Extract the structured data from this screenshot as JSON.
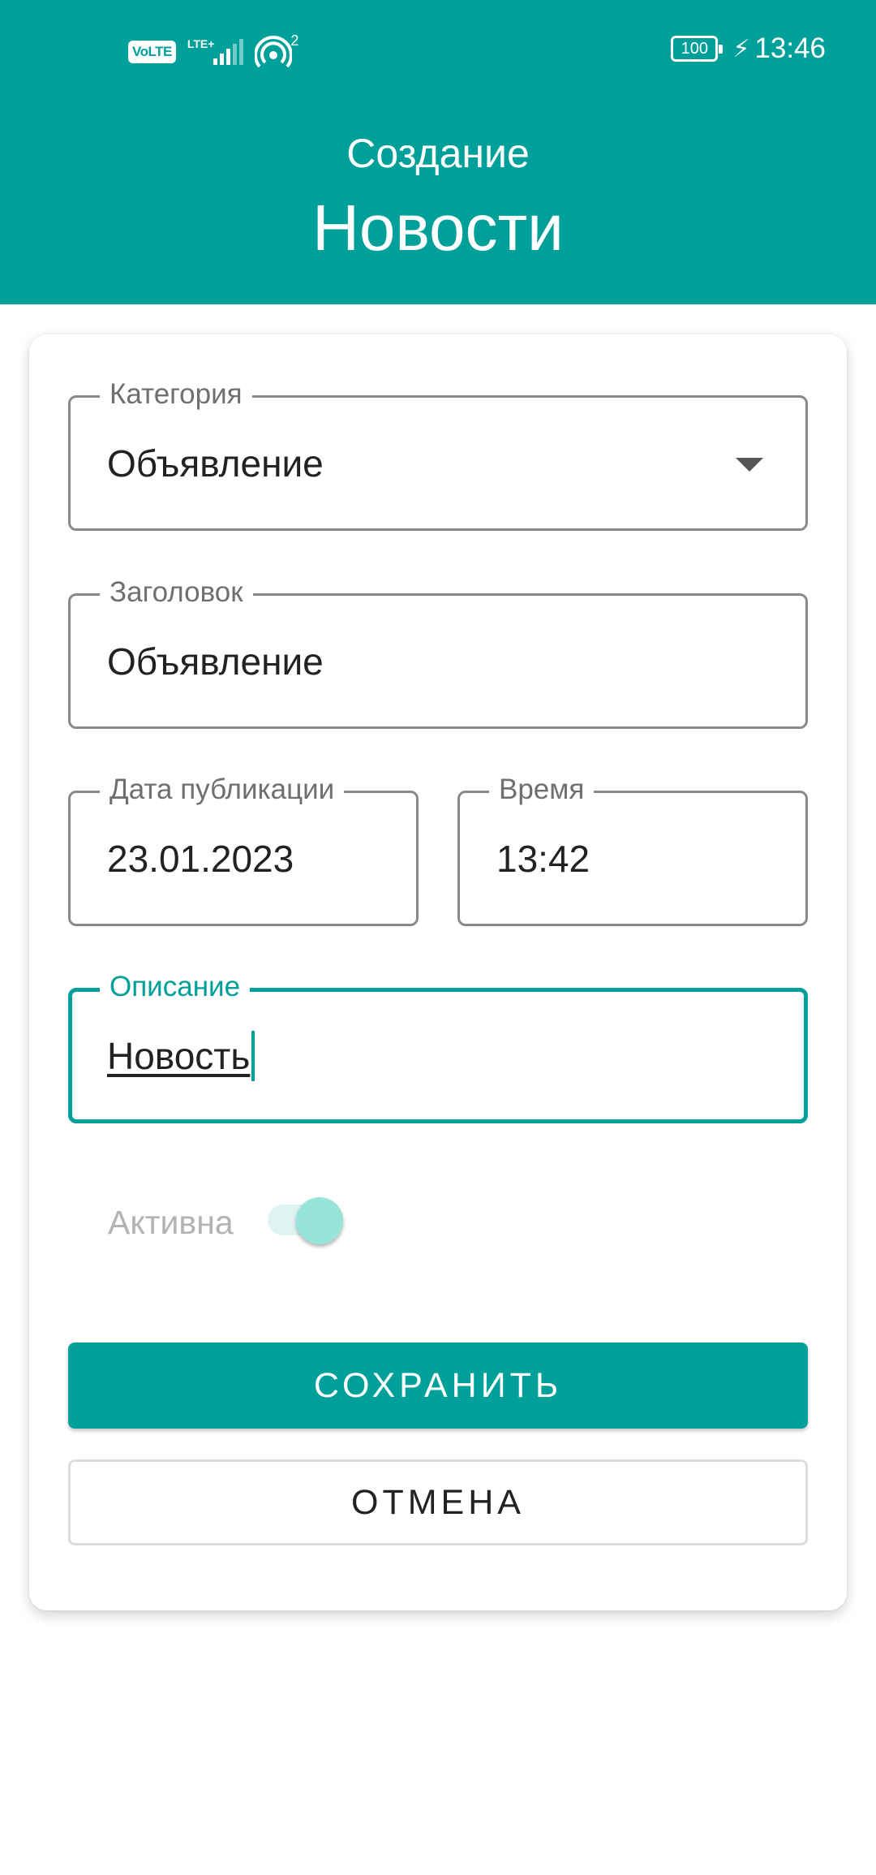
{
  "status_bar": {
    "volte": "VoLTE",
    "lte": "LTE+",
    "hotspot_count": "2",
    "battery": "100",
    "time": "13:46"
  },
  "header": {
    "subtitle": "Создание",
    "title": "Новости",
    "color": "#00A09A"
  },
  "form": {
    "category": {
      "label": "Категория",
      "value": "Объявление"
    },
    "headline": {
      "label": "Заголовок",
      "value": "Объявление"
    },
    "publish_date": {
      "label": "Дата публикации",
      "value": "23.01.2023"
    },
    "time": {
      "label": "Время",
      "value": "13:42"
    },
    "description": {
      "label": "Описание",
      "value": "Новость"
    },
    "active": {
      "label": "Активна",
      "checked": true
    }
  },
  "buttons": {
    "save": "СОХРАНИТЬ",
    "cancel": "ОТМЕНА"
  }
}
